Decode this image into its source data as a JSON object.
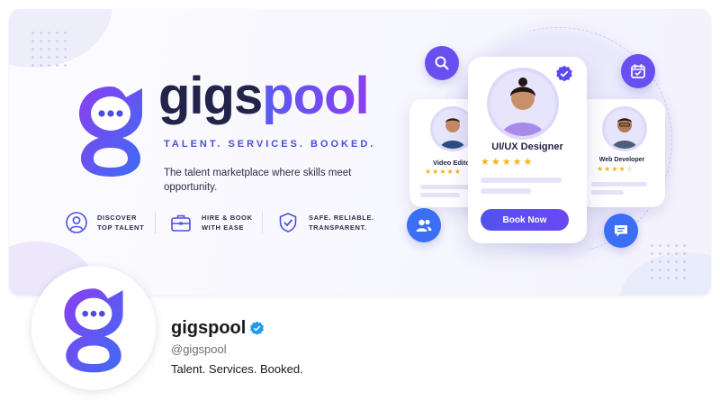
{
  "banner": {
    "brand": {
      "name_part1": "gigs",
      "name_part2": "pool",
      "tagline": "TALENT. SERVICES. BOOKED."
    },
    "description": "The talent marketplace where skills meet opportunity.",
    "features": [
      {
        "icon": "user-circle-icon",
        "line1": "DISCOVER",
        "line2": "TOP TALENT"
      },
      {
        "icon": "briefcase-icon",
        "line1": "HIRE & BOOK",
        "line2": "WITH EASE"
      },
      {
        "icon": "shield-check-icon",
        "line1": "SAFE. RELIABLE.",
        "line2": "TRANSPARENT."
      }
    ],
    "illustration": {
      "left_card": {
        "role": "Video Editor",
        "rating": 5,
        "stars": "★★★★★"
      },
      "main_card": {
        "role": "UI/UX Designer",
        "rating": 5,
        "stars": "★★★★★",
        "button": "Book Now"
      },
      "right_card": {
        "role": "Web Developer",
        "rating": 4.5,
        "stars": "★★★★☆"
      },
      "icons": [
        "search-icon",
        "calendar-check-icon",
        "users-icon",
        "chat-icon",
        "verified-badge-icon"
      ]
    }
  },
  "profile": {
    "name": "gigspool",
    "verified": true,
    "handle": "@gigspool",
    "tagline": "Talent. Services. Booked."
  },
  "colors": {
    "brand_blue": "#5153ee",
    "brand_purple": "#8b3ff0",
    "dark_text": "#22244a",
    "star": "#f4b21b",
    "verified": "#1d9bf0"
  }
}
